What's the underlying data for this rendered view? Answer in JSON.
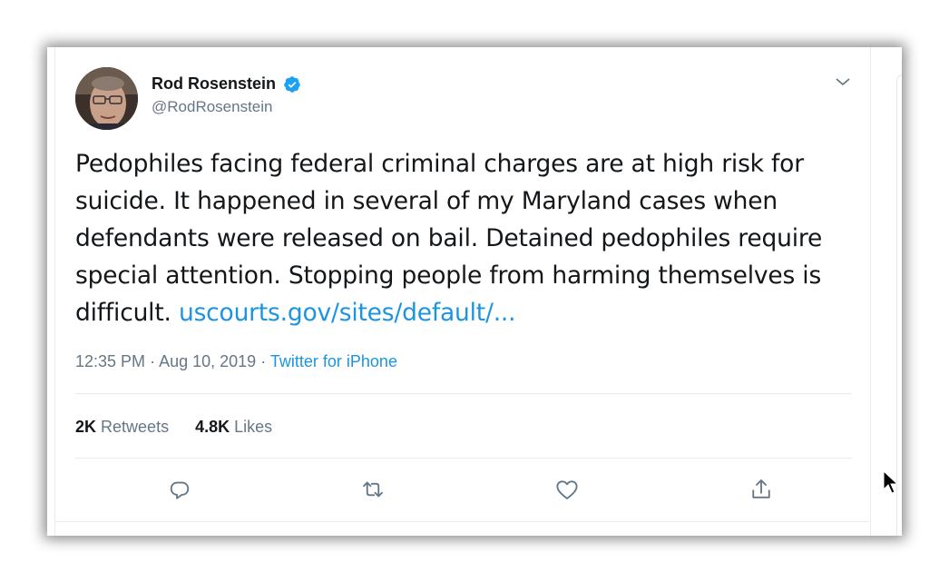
{
  "tweet": {
    "display_name": "Rod Rosenstein",
    "handle": "@RodRosenstein",
    "text_parts": {
      "body": "Pedophiles facing federal criminal charges are at high risk for suicide. It happened in several of my Maryland cases when defendants were released on bail. Detained pedophiles require special attention. Stopping people from harming themselves is difficult. ",
      "link": "uscourts.gov/sites/default/..."
    },
    "time": "12:35 PM",
    "separator": "·",
    "date": "Aug 10, 2019",
    "source": "Twitter for iPhone"
  },
  "stats": {
    "retweets_count": "2K",
    "retweets_label": "Retweets",
    "likes_count": "4.8K",
    "likes_label": "Likes"
  },
  "icons": {
    "verified": "verified-badge-icon",
    "caret": "chevron-down-icon",
    "reply": "reply-icon",
    "retweet": "retweet-icon",
    "like": "heart-icon",
    "share": "share-icon"
  },
  "colors": {
    "link": "#1b95e0",
    "text": "#14171a",
    "secondary": "#657786",
    "verified": "#1da1f2"
  }
}
